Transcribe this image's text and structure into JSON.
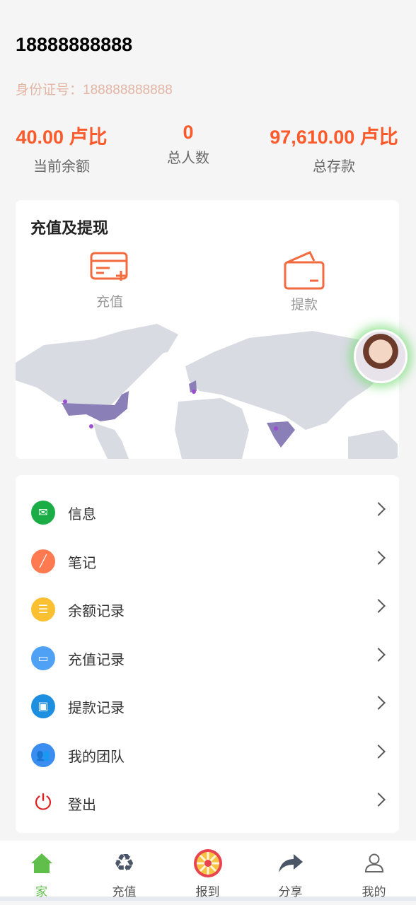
{
  "user": {
    "phone": "18888888888",
    "id_label": "身份证号：",
    "id_value": "188888888888"
  },
  "stats": [
    {
      "value": "40.00 卢比",
      "label": "当前余额"
    },
    {
      "value": "0",
      "label": "总人数"
    },
    {
      "value": "97,610.00 卢比",
      "label": "总存款"
    }
  ],
  "funds": {
    "title": "充值及提现",
    "recharge": "充值",
    "withdraw": "提款"
  },
  "menu": [
    {
      "label": "信息",
      "icon": "mail-icon",
      "color": "#1aad45"
    },
    {
      "label": "笔记",
      "icon": "pen-icon",
      "color": "#ff7a50"
    },
    {
      "label": "余额记录",
      "icon": "list-icon",
      "color": "#fbbf32"
    },
    {
      "label": "充值记录",
      "icon": "laptop-icon",
      "color": "#4ea1f5"
    },
    {
      "label": "提款记录",
      "icon": "wallet-icon",
      "color": "#1d8fe0"
    },
    {
      "label": "我的团队",
      "icon": "team-icon",
      "color": "#3b8ef0"
    },
    {
      "label": "登出",
      "icon": "power-icon",
      "color": "#e02020"
    }
  ],
  "tabs": [
    {
      "label": "家",
      "active": true
    },
    {
      "label": "充值"
    },
    {
      "label": "报到"
    },
    {
      "label": "分享"
    },
    {
      "label": "我的"
    }
  ],
  "colors": {
    "accent": "#fc5a2b",
    "active_tab": "#5fbf4a"
  }
}
